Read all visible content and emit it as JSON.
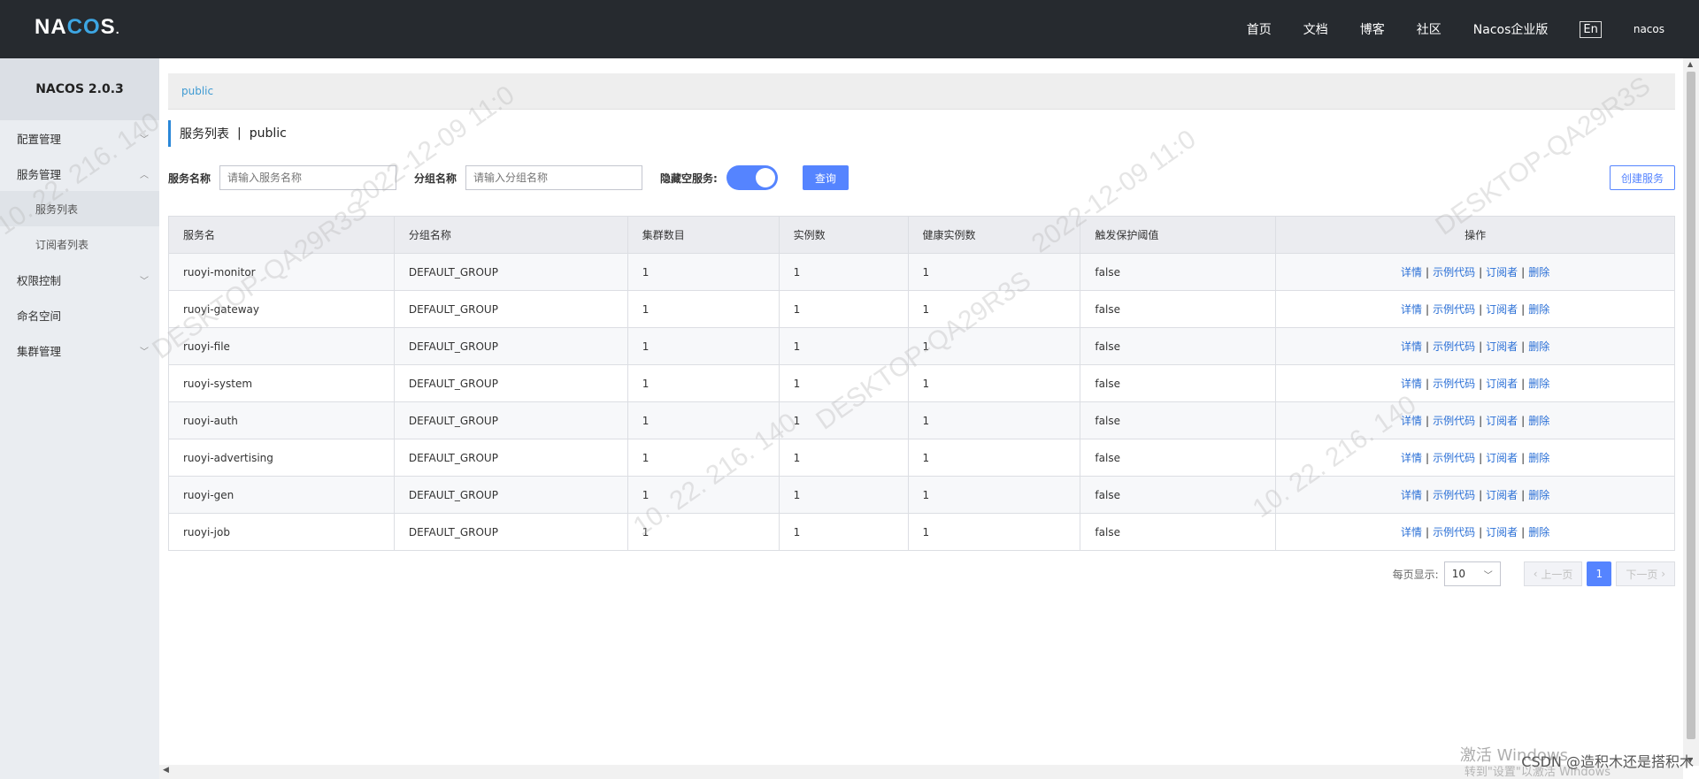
{
  "header": {
    "logo": {
      "pre": "NA",
      "mid": "CO",
      "post": "S",
      "dot": "."
    },
    "nav": [
      "首页",
      "文档",
      "博客",
      "社区",
      "Nacos企业版"
    ],
    "lang": "En",
    "user": "nacos"
  },
  "sidebar": {
    "title": "NACOS 2.0.3",
    "items": [
      {
        "label": "配置管理"
      },
      {
        "label": "服务管理"
      },
      {
        "label": "服务列表"
      },
      {
        "label": "订阅者列表"
      },
      {
        "label": "权限控制"
      },
      {
        "label": "命名空间"
      },
      {
        "label": "集群管理"
      }
    ]
  },
  "namespace": {
    "tag": "public"
  },
  "page": {
    "title": "服务列表",
    "sep": "|",
    "ns": "public"
  },
  "filter": {
    "service_label": "服务名称",
    "service_placeholder": "请输入服务名称",
    "group_label": "分组名称",
    "group_placeholder": "请输入分组名称",
    "hide_empty_label": "隐藏空服务:",
    "hide_empty_on": true,
    "query_label": "查询",
    "create_label": "创建服务"
  },
  "table": {
    "columns": [
      "服务名",
      "分组名称",
      "集群数目",
      "实例数",
      "健康实例数",
      "触发保护阈值",
      "操作"
    ],
    "ops": [
      "详情",
      "示例代码",
      "订阅者",
      "删除"
    ],
    "rows": [
      {
        "name": "ruoyi-monitor",
        "group": "DEFAULT_GROUP",
        "clusters": "1",
        "instances": "1",
        "healthy": "1",
        "threshold": "false"
      },
      {
        "name": "ruoyi-gateway",
        "group": "DEFAULT_GROUP",
        "clusters": "1",
        "instances": "1",
        "healthy": "1",
        "threshold": "false"
      },
      {
        "name": "ruoyi-file",
        "group": "DEFAULT_GROUP",
        "clusters": "1",
        "instances": "1",
        "healthy": "1",
        "threshold": "false"
      },
      {
        "name": "ruoyi-system",
        "group": "DEFAULT_GROUP",
        "clusters": "1",
        "instances": "1",
        "healthy": "1",
        "threshold": "false"
      },
      {
        "name": "ruoyi-auth",
        "group": "DEFAULT_GROUP",
        "clusters": "1",
        "instances": "1",
        "healthy": "1",
        "threshold": "false"
      },
      {
        "name": "ruoyi-advertising",
        "group": "DEFAULT_GROUP",
        "clusters": "1",
        "instances": "1",
        "healthy": "1",
        "threshold": "false"
      },
      {
        "name": "ruoyi-gen",
        "group": "DEFAULT_GROUP",
        "clusters": "1",
        "instances": "1",
        "healthy": "1",
        "threshold": "false"
      },
      {
        "name": "ruoyi-job",
        "group": "DEFAULT_GROUP",
        "clusters": "1",
        "instances": "1",
        "healthy": "1",
        "threshold": "false"
      }
    ]
  },
  "pager": {
    "page_size_label": "每页显示:",
    "page_size": "10",
    "prev": "上一页",
    "next": "下一页",
    "current": "1"
  },
  "watermark": {
    "ip": "10. 22. 216. 140",
    "host": "DESKTOP-QA29R3S",
    "date": "2022-12-09 11:0"
  },
  "overlay": {
    "win_activate": "激活 Windows",
    "win_activate_sub": "转到\"设置\"以激活 Windows",
    "csdn": "CSDN @造积木还是搭积木"
  },
  "colors": {
    "accent": "#5584ff",
    "header_bg": "#262a2f",
    "link": "#2a6fd6"
  }
}
